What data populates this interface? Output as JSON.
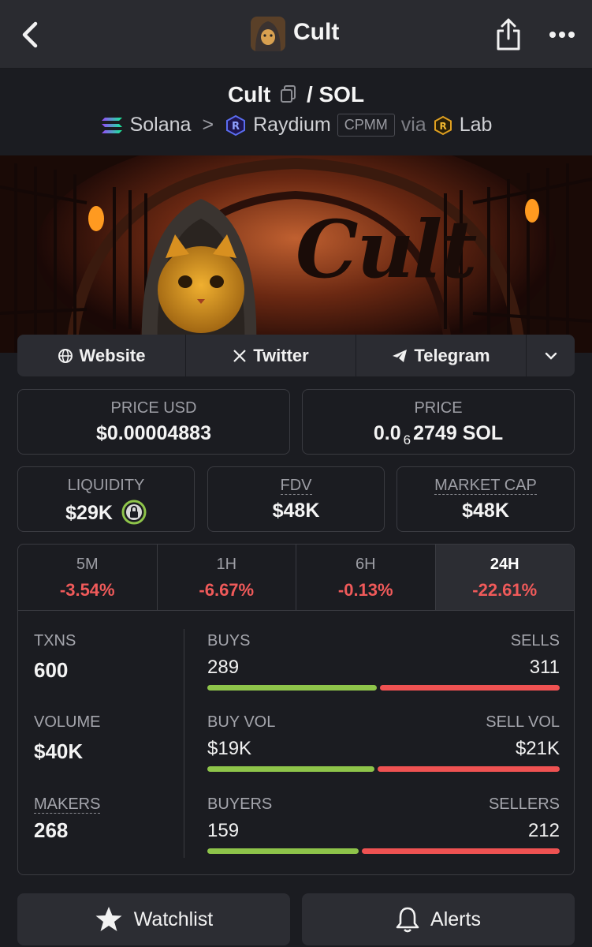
{
  "topbar": {
    "title": "Cult"
  },
  "pair": {
    "base": "Cult",
    "quote": "SOL",
    "chain": "Solana",
    "dex": "Raydium",
    "pool_type": "CPMM",
    "via_label": "via",
    "launchpad": "Lab"
  },
  "banner": {
    "title": "Cult"
  },
  "socials": {
    "website": "Website",
    "twitter": "Twitter",
    "telegram": "Telegram"
  },
  "prices": {
    "usd_label": "PRICE USD",
    "usd_value": "$0.00004883",
    "native_label": "PRICE",
    "native_prefix": "0.0",
    "native_sub": "6",
    "native_rest": "2749 SOL"
  },
  "metrics": {
    "liquidity_label": "LIQUIDITY",
    "liquidity_value": "$29K",
    "fdv_label": "FDV",
    "fdv_value": "$48K",
    "mcap_label": "MARKET CAP",
    "mcap_value": "$48K"
  },
  "timeframes": [
    {
      "label": "5M",
      "change": "-3.54%"
    },
    {
      "label": "1H",
      "change": "-6.67%"
    },
    {
      "label": "6H",
      "change": "-0.13%"
    },
    {
      "label": "24H",
      "change": "-22.61%"
    }
  ],
  "stats": {
    "txns_label": "TXNS",
    "txns_value": "600",
    "volume_label": "VOLUME",
    "volume_value": "$40K",
    "makers_label": "MAKERS",
    "makers_value": "268",
    "buys_label": "BUYS",
    "buys_value": "289",
    "sells_label": "SELLS",
    "sells_value": "311",
    "buyvol_label": "BUY VOL",
    "buyvol_value": "$19K",
    "sellvol_label": "SELL VOL",
    "sellvol_value": "$21K",
    "buyers_label": "BUYERS",
    "buyers_value": "159",
    "sellers_label": "SELLERS",
    "sellers_value": "212",
    "buys_fraction": 0.482,
    "buyvol_fraction": 0.475,
    "buyers_fraction": 0.429
  },
  "actions": {
    "watchlist": "Watchlist",
    "alerts": "Alerts"
  },
  "colors": {
    "positive": "#8ec44a",
    "negative": "#ef5252",
    "background": "#1b1c21",
    "panel": "#2b2c32"
  }
}
